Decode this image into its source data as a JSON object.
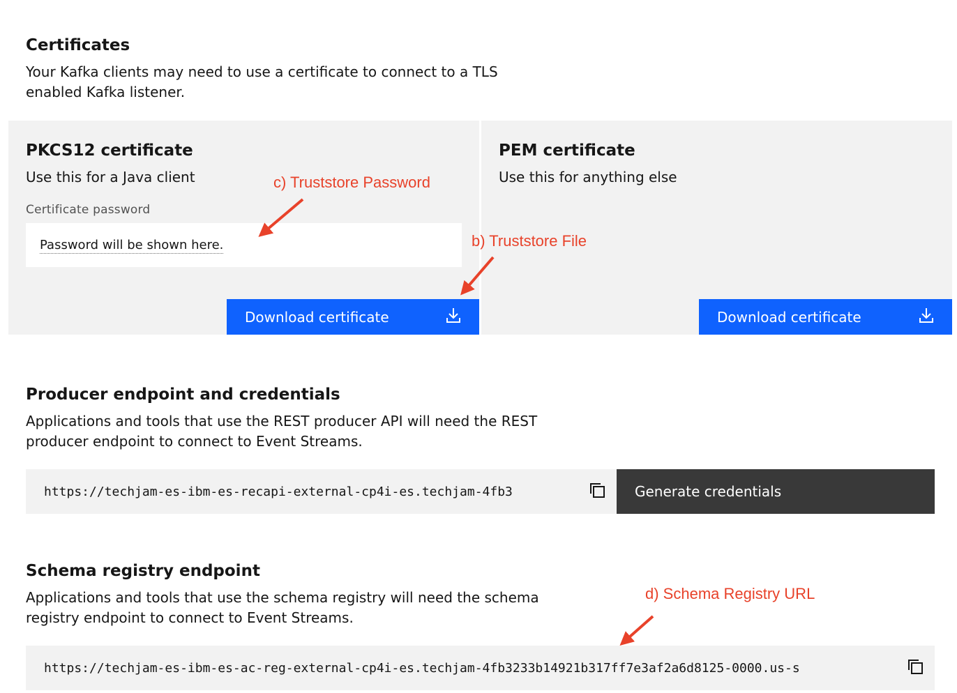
{
  "certificates": {
    "title": "Certificates",
    "description": "Your Kafka clients may need to use a certificate to connect to a TLS enabled Kafka listener.",
    "pkcs12": {
      "title": "PKCS12 certificate",
      "subtitle": "Use this for a Java client",
      "password_label": "Certificate password",
      "password_value": "Password will be shown here.",
      "download_label": "Download certificate",
      "download_icon": "download-icon"
    },
    "pem": {
      "title": "PEM certificate",
      "subtitle": "Use this for anything else",
      "download_label": "Download certificate",
      "download_icon": "download-icon"
    }
  },
  "producer": {
    "title": "Producer endpoint and credentials",
    "description": "Applications and tools that use the REST producer API will need the REST producer endpoint to connect to Event Streams.",
    "endpoint": "https://techjam-es-ibm-es-recapi-external-cp4i-es.techjam-4fb3",
    "copy_icon": "copy-icon",
    "generate_label": "Generate credentials"
  },
  "schema_registry": {
    "title": "Schema registry endpoint",
    "description": "Applications and tools that use the schema registry will need the schema registry endpoint to connect to Event Streams.",
    "endpoint": "https://techjam-es-ibm-es-ac-reg-external-cp4i-es.techjam-4fb3233b14921b317ff7e3af2a6d8125-0000.us-s",
    "copy_icon": "copy-icon"
  },
  "annotations": {
    "truststore_password": "c) Truststore Password",
    "truststore_file": "b) Truststore File",
    "schema_registry_url": "d) Schema Registry URL"
  },
  "colors": {
    "primary_button": "#0f62fe",
    "dark_button": "#393939",
    "tile_background": "#f2f2f2",
    "annotation": "#e8422a"
  }
}
